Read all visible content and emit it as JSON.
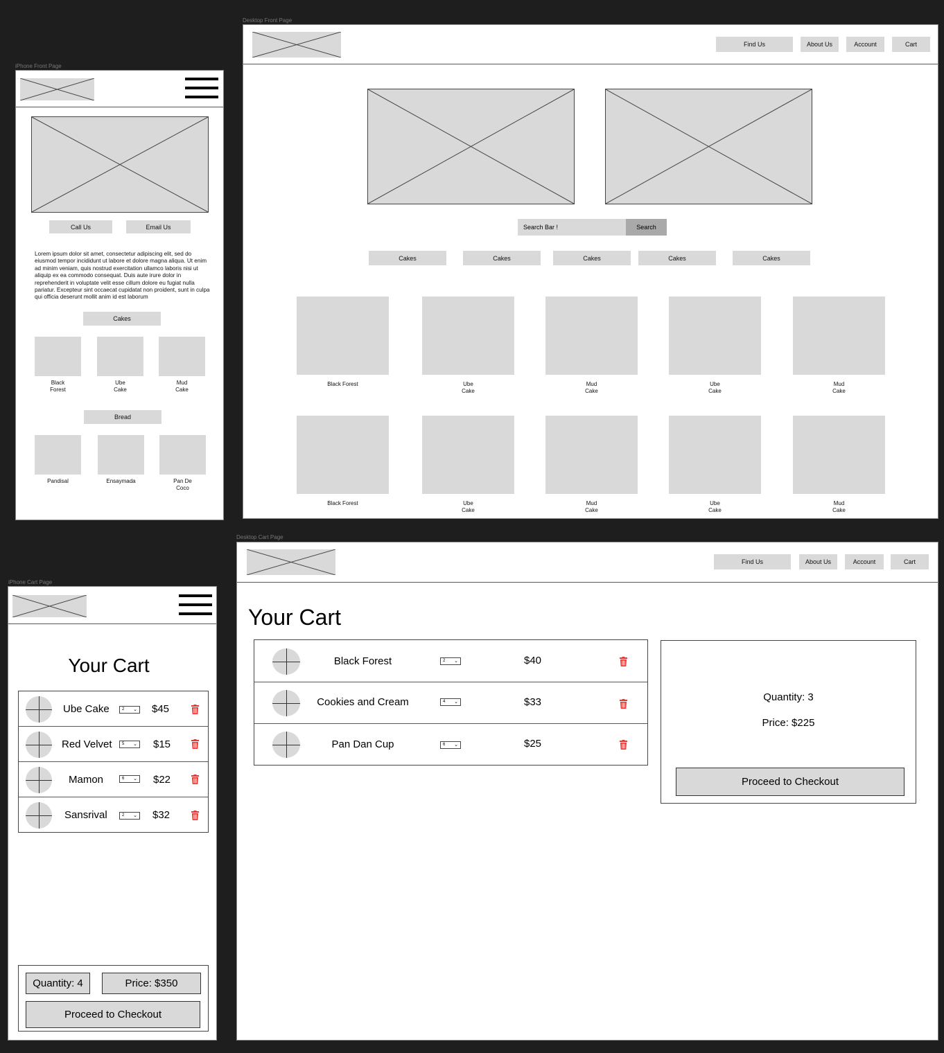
{
  "frames": {
    "iphone_front": "iPhone Front Page",
    "desktop_front": "Desktop Front Page",
    "iphone_cart": "iPhone Cart Page",
    "desktop_cart": "Desktop Cart Page"
  },
  "nav": [
    "Find Us",
    "About Us",
    "Account",
    "Cart"
  ],
  "iphone_front": {
    "call_label": "Call Us",
    "email_label": "Email Us",
    "lorem": "Lorem ipsum dolor sit amet, consectetur adipiscing elit, sed do eiusmod tempor incididunt ut labore et dolore magna aliqua. Ut enim ad minim veniam, quis nostrud exercitation ullamco laboris nisi ut aliquip ex ea commodo consequat. Duis aute irure dolor in reprehenderit in voluptate velit esse cillum dolore eu fugiat nulla pariatur. Excepteur sint occaecat cupidatat non proident, sunt in culpa qui officia deserunt mollit anim id est laborum",
    "cakes_label": "Cakes",
    "cakes": [
      "Black\nForest",
      "Ube\nCake",
      "Mud\nCake"
    ],
    "bread_label": "Bread",
    "breads": [
      "Pandisal",
      "Ensaymada",
      "Pan De\nCoco"
    ]
  },
  "desktop_front": {
    "search_placeholder": "Search Bar !",
    "search_button": "Search",
    "categories": [
      "Cakes",
      "Cakes",
      "Cakes",
      "Cakes",
      "Cakes"
    ],
    "row1": [
      "Black Forest",
      "Ube\nCake",
      "Mud\nCake",
      "Ube\nCake",
      "Mud\nCake"
    ],
    "row2": [
      "Black Forest",
      "Ube\nCake",
      "Mud\nCake",
      "Ube\nCake",
      "Mud\nCake"
    ]
  },
  "iphone_cart": {
    "title": "Your Cart",
    "items": [
      {
        "name": "Ube Cake",
        "qty": "2",
        "price": "$45"
      },
      {
        "name": "Red Velvet",
        "qty": "5",
        "price": "$15"
      },
      {
        "name": "Mamon",
        "qty": "6",
        "price": "$22"
      },
      {
        "name": "Sansrival",
        "qty": "2",
        "price": "$32"
      }
    ],
    "quantity": "Quantity: 4",
    "price": "Price: $350",
    "checkout": "Proceed to Checkout"
  },
  "desktop_cart": {
    "title": "Your Cart",
    "items": [
      {
        "name": "Black Forest",
        "qty": "2",
        "price": "$40"
      },
      {
        "name": "Cookies and Cream",
        "qty": "4",
        "price": "$33"
      },
      {
        "name": "Pan Dan Cup",
        "qty": "6",
        "price": "$25"
      }
    ],
    "quantity": "Quantity: 3",
    "price": "Price: $225",
    "checkout": "Proceed to Checkout"
  },
  "colors": {
    "canvas": "#1e1e1e",
    "placeholder": "#d9d9d9",
    "trash": "#e53935",
    "search_button": "#a9a9a9"
  }
}
